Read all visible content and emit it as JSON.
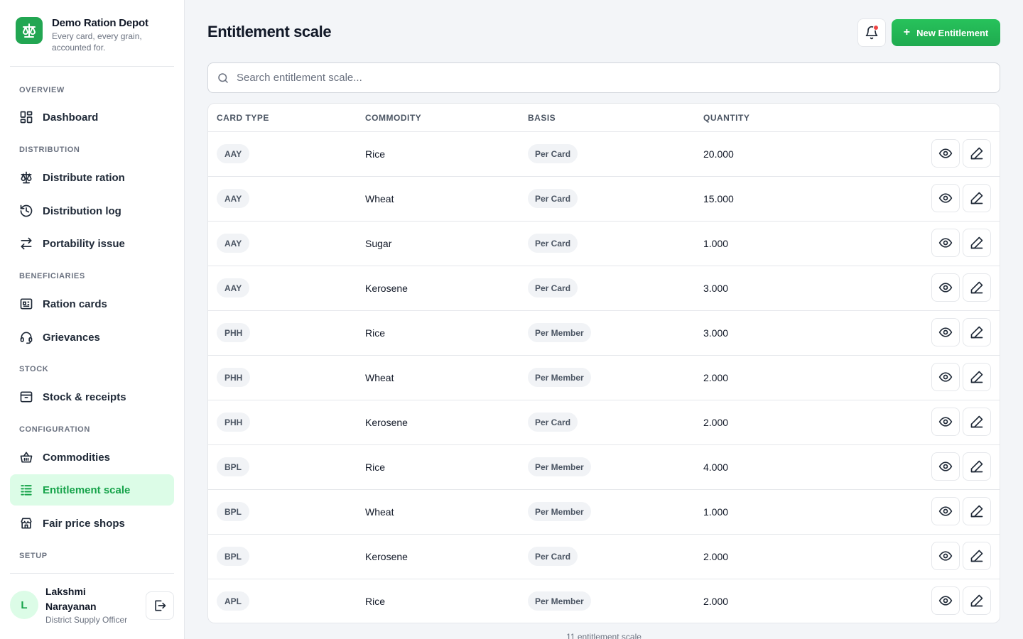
{
  "brand": {
    "name": "Demo Ration Depot",
    "tagline": "Every card, every grain, accounted for."
  },
  "sidebar": {
    "sections": [
      {
        "title": "OVERVIEW"
      },
      {
        "title": "DISTRIBUTION"
      },
      {
        "title": "BENEFICIARIES"
      },
      {
        "title": "STOCK"
      },
      {
        "title": "CONFIGURATION"
      },
      {
        "title": "SETUP"
      }
    ],
    "items": [
      {
        "label": "Dashboard",
        "icon": "dashboard-icon"
      },
      {
        "label": "Distribute ration",
        "icon": "scale-icon"
      },
      {
        "label": "Distribution log",
        "icon": "history-icon"
      },
      {
        "label": "Portability issue",
        "icon": "swap-icon"
      },
      {
        "label": "Ration cards",
        "icon": "card-icon"
      },
      {
        "label": "Grievances",
        "icon": "headset-icon"
      },
      {
        "label": "Stock & receipts",
        "icon": "archive-icon"
      },
      {
        "label": "Commodities",
        "icon": "basket-icon"
      },
      {
        "label": "Entitlement scale",
        "icon": "list-icon",
        "active": true
      },
      {
        "label": "Fair price shops",
        "icon": "store-icon"
      }
    ]
  },
  "user": {
    "initial": "L",
    "name": "Lakshmi Narayanan",
    "role": "District Supply Officer"
  },
  "header": {
    "title": "Entitlement scale",
    "new_button_label": "New Entitlement"
  },
  "search": {
    "placeholder": "Search entitlement scale..."
  },
  "table": {
    "columns": [
      "CARD TYPE",
      "COMMODITY",
      "BASIS",
      "QUANTITY"
    ],
    "rows": [
      {
        "card_type": "AAY",
        "commodity": "Rice",
        "basis": "Per Card",
        "quantity": "20.000"
      },
      {
        "card_type": "AAY",
        "commodity": "Wheat",
        "basis": "Per Card",
        "quantity": "15.000"
      },
      {
        "card_type": "AAY",
        "commodity": "Sugar",
        "basis": "Per Card",
        "quantity": "1.000"
      },
      {
        "card_type": "AAY",
        "commodity": "Kerosene",
        "basis": "Per Card",
        "quantity": "3.000"
      },
      {
        "card_type": "PHH",
        "commodity": "Rice",
        "basis": "Per Member",
        "quantity": "3.000"
      },
      {
        "card_type": "PHH",
        "commodity": "Wheat",
        "basis": "Per Member",
        "quantity": "2.000"
      },
      {
        "card_type": "PHH",
        "commodity": "Kerosene",
        "basis": "Per Card",
        "quantity": "2.000"
      },
      {
        "card_type": "BPL",
        "commodity": "Rice",
        "basis": "Per Member",
        "quantity": "4.000"
      },
      {
        "card_type": "BPL",
        "commodity": "Wheat",
        "basis": "Per Member",
        "quantity": "1.000"
      },
      {
        "card_type": "BPL",
        "commodity": "Kerosene",
        "basis": "Per Card",
        "quantity": "2.000"
      },
      {
        "card_type": "APL",
        "commodity": "Rice",
        "basis": "Per Member",
        "quantity": "2.000"
      }
    ],
    "footer": "11 entitlement scale"
  },
  "colors": {
    "accent": "#16a34a",
    "accent_bg": "#dcfce7",
    "notification": "#ef4444"
  }
}
